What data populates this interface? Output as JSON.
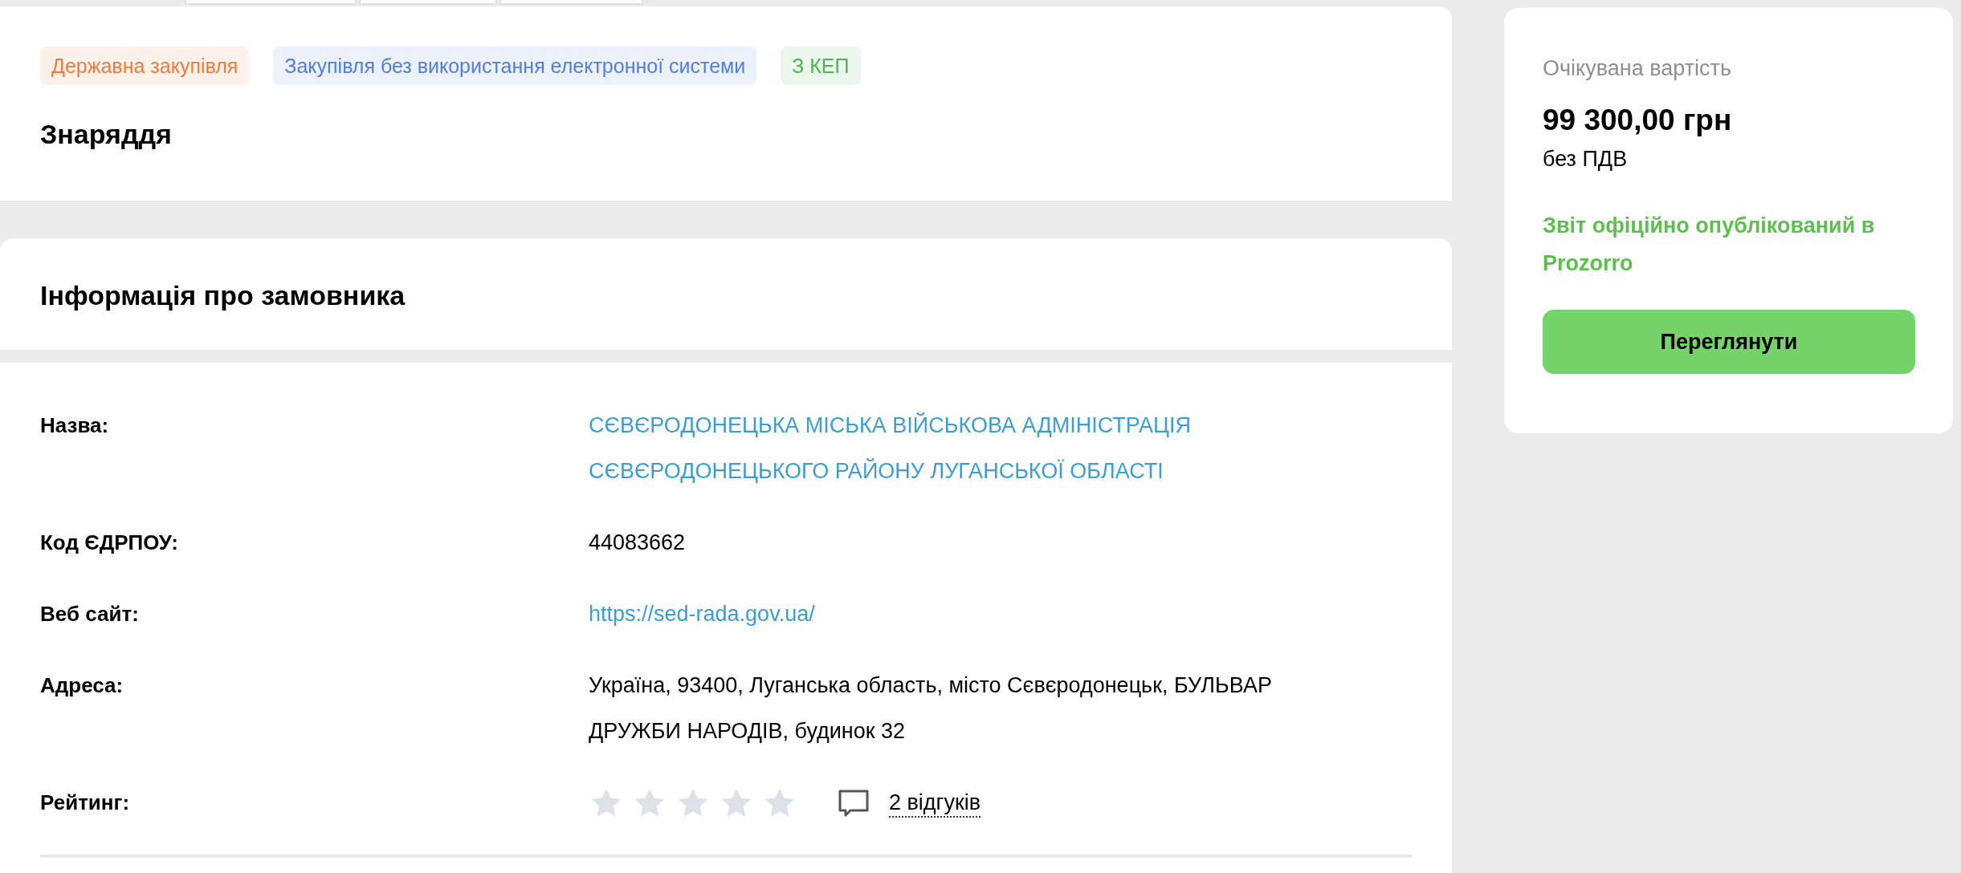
{
  "tags": [
    {
      "label": "Державна закупівля",
      "color": "#f07b3f"
    },
    {
      "label": "Закупівля без використання електронної системи",
      "color": "#4f7fe3"
    },
    {
      "label": "З КЕП",
      "color": "#4cb450"
    }
  ],
  "title": "Знаряддя",
  "customer": {
    "heading": "Інформація про замовника",
    "rows": [
      {
        "kind": "link",
        "label": "Назва:",
        "value": "СЄВЄРОДОНЕЦЬКА МІСЬКА ВІЙСЬКОВА АДМІНІСТРАЦІЯ СЄВЄРОДОНЕЦЬКОГО РАЙОНУ ЛУГАНСЬКОЇ ОБЛАСТІ"
      },
      {
        "kind": "text",
        "label": "Код ЄДРПОУ:",
        "value": "44083662"
      },
      {
        "kind": "link",
        "label": "Веб сайт:",
        "value": "https://sed-rada.gov.ua/"
      },
      {
        "kind": "text",
        "label": "Адреса:",
        "value": "Україна, 93400, Луганська область, місто Сєвєродонецьк, БУЛЬВАР ДРУЖБИ НАРОДІВ, будинок 32"
      },
      {
        "kind": "rating",
        "label": "Рейтинг:",
        "stars": 0,
        "reviews": "2 відгуків"
      }
    ]
  },
  "price_card": {
    "label": "Очікувана вартість",
    "amount": "99 300,00 грн",
    "vat": "без ПДВ",
    "status": "Звіт офіційно опублікований в Prozorro",
    "button": "Переглянути"
  }
}
